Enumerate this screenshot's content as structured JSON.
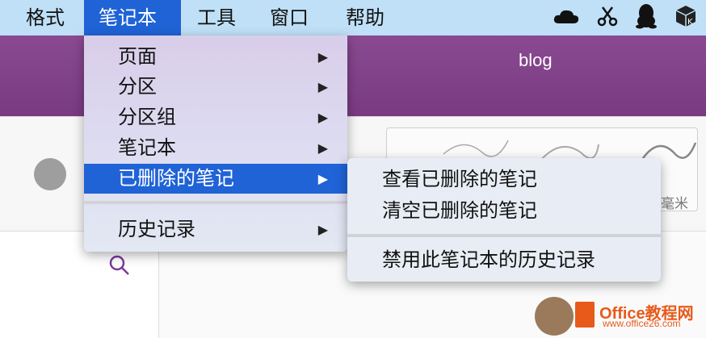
{
  "menubar": {
    "items": [
      "格式",
      "笔记本",
      "工具",
      "窗口",
      "帮助"
    ],
    "active_index": 1,
    "status_icons": [
      "onedrive-cloud-icon",
      "scissors-icon",
      "qq-penguin-icon",
      "box-k-icon"
    ]
  },
  "window": {
    "title": "blog"
  },
  "ribbon": {
    "unit_label": "毫米"
  },
  "notebook_menu": {
    "items": [
      {
        "label": "页面",
        "has_submenu": true
      },
      {
        "label": "分区",
        "has_submenu": true
      },
      {
        "label": "分区组",
        "has_submenu": true
      },
      {
        "label": "笔记本",
        "has_submenu": true
      },
      {
        "label": "已删除的笔记",
        "has_submenu": true,
        "highlighted": true
      },
      {
        "label": "历史记录",
        "has_submenu": true
      }
    ]
  },
  "deleted_notes_submenu": {
    "items": [
      "查看已删除的笔记",
      "清空已删除的笔记",
      "禁用此笔记本的历史记录"
    ]
  },
  "watermark": {
    "brand": "Office教程网",
    "url": "www.office26.com"
  },
  "colors": {
    "menubar_bg": "#bfe0f7",
    "highlight": "#1f63d6",
    "app_purple": "#7e3f86",
    "search_icon": "#7a3a9a"
  }
}
